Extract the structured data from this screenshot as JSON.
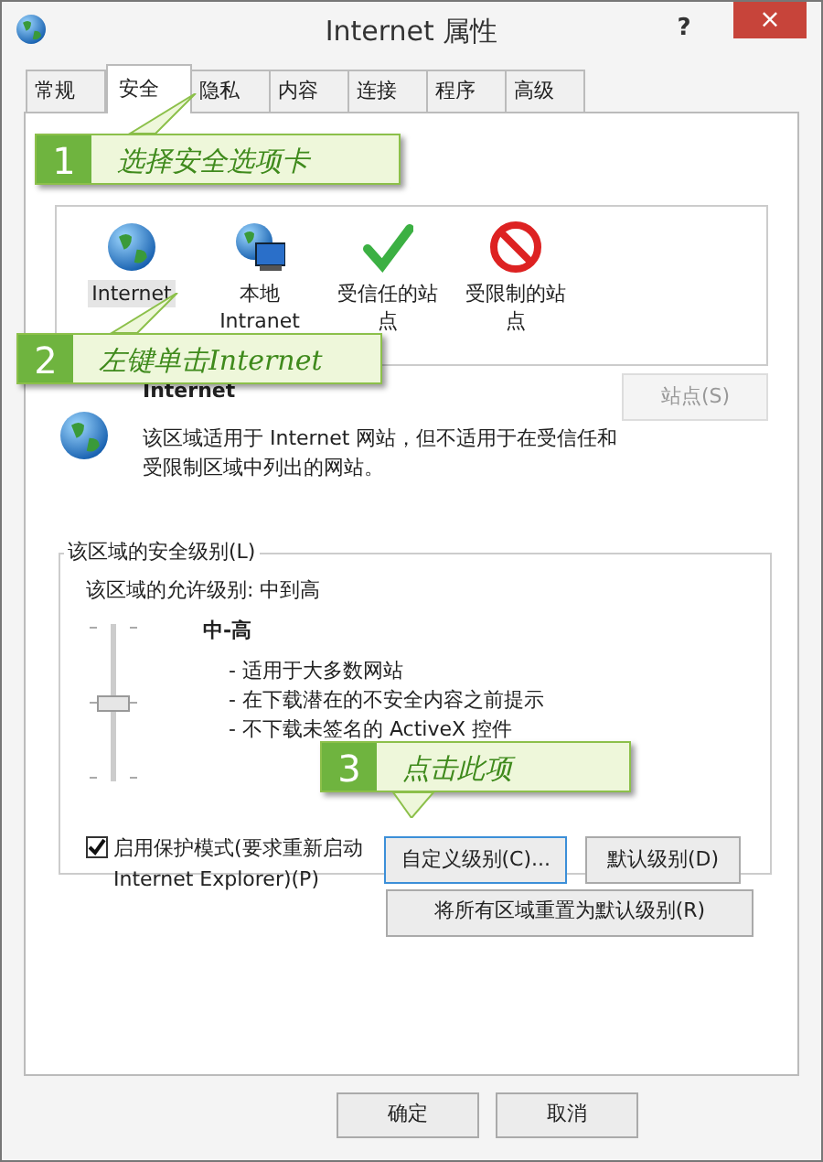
{
  "window": {
    "title": "Internet 属性",
    "help_button": "?",
    "close_button": "×"
  },
  "tabs": [
    {
      "label": "常规",
      "selected": false
    },
    {
      "label": "安全",
      "selected": true
    },
    {
      "label": "隐私",
      "selected": false
    },
    {
      "label": "内容",
      "selected": false
    },
    {
      "label": "连接",
      "selected": false
    },
    {
      "label": "程序",
      "selected": false
    },
    {
      "label": "高级",
      "selected": false
    }
  ],
  "zones": [
    {
      "label": "Internet",
      "kind": "globe",
      "selected": true
    },
    {
      "label": "本地 Intranet",
      "kind": "intranet",
      "selected": false
    },
    {
      "label": "受信任的站点",
      "kind": "trusted",
      "selected": false
    },
    {
      "label": "受限制的站点",
      "kind": "restricted",
      "selected": false
    }
  ],
  "zone_info": {
    "title": "Internet",
    "description": "该区域适用于 Internet 网站，但不适用于在受信任和受限制区域中列出的网站。",
    "sites_button": {
      "label": "站点(S)",
      "disabled": true
    }
  },
  "security_level": {
    "group_title": "该区域的安全级别(L)",
    "allowed": "该区域的允许级别: 中到高",
    "slider": {
      "level": 0.5
    },
    "level_name": "中-高",
    "bullets": [
      "- 适用于大多数网站",
      "- 在下载潜在的不安全内容之前提示",
      "- 不下载未签名的 ActiveX 控件"
    ],
    "protected_mode": {
      "label": "启用保护模式(要求重新启动 Internet Explorer)(P)",
      "checked": true
    },
    "buttons": [
      {
        "label": "自定义级别(C)...",
        "focused": true
      },
      {
        "label": "默认级别(D)",
        "focused": false
      }
    ]
  },
  "reset_button": "将所有区域重置为默认级别(R)",
  "dialog_buttons": [
    "确定",
    "取消"
  ],
  "callouts": [
    {
      "number": "1",
      "text": "选择安全选项卡"
    },
    {
      "number": "2",
      "text": "左键单击Internet"
    },
    {
      "number": "3",
      "text": "点击此项"
    }
  ]
}
